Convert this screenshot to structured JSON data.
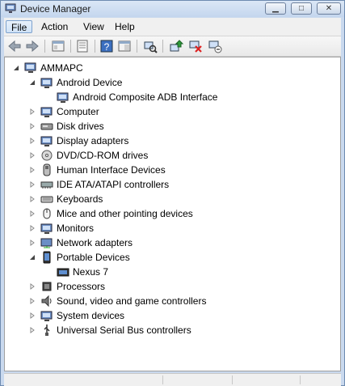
{
  "window": {
    "title": "Device Manager"
  },
  "menu": {
    "items": [
      "File",
      "Action",
      "View",
      "Help"
    ]
  },
  "tree": {
    "root": "AMMAPC",
    "nodes": [
      {
        "label": "Android Device",
        "icon": "android-device-icon",
        "expanded": true
      },
      {
        "label": "Android Composite ADB Interface",
        "icon": "adb-interface-icon",
        "child": true
      },
      {
        "label": "Computer",
        "icon": "computer-icon"
      },
      {
        "label": "Disk drives",
        "icon": "disk-drive-icon"
      },
      {
        "label": "Display adapters",
        "icon": "display-adapter-icon"
      },
      {
        "label": "DVD/CD-ROM drives",
        "icon": "dvd-drive-icon"
      },
      {
        "label": "Human Interface Devices",
        "icon": "hid-icon"
      },
      {
        "label": "IDE ATA/ATAPI controllers",
        "icon": "ide-controller-icon"
      },
      {
        "label": "Keyboards",
        "icon": "keyboard-icon"
      },
      {
        "label": "Mice and other pointing devices",
        "icon": "mouse-icon"
      },
      {
        "label": "Monitors",
        "icon": "monitor-icon"
      },
      {
        "label": "Network adapters",
        "icon": "network-adapter-icon"
      },
      {
        "label": "Portable Devices",
        "icon": "portable-device-icon",
        "expanded": true
      },
      {
        "label": "Nexus 7",
        "icon": "nexus-device-icon",
        "child": true
      },
      {
        "label": "Processors",
        "icon": "processor-icon"
      },
      {
        "label": "Sound, video and game controllers",
        "icon": "sound-icon"
      },
      {
        "label": "System devices",
        "icon": "system-device-icon"
      },
      {
        "label": "Universal Serial Bus controllers",
        "icon": "usb-icon"
      }
    ]
  },
  "colors": {
    "titlebar": "#c4d6ee",
    "accent": "#3a6fb0"
  }
}
